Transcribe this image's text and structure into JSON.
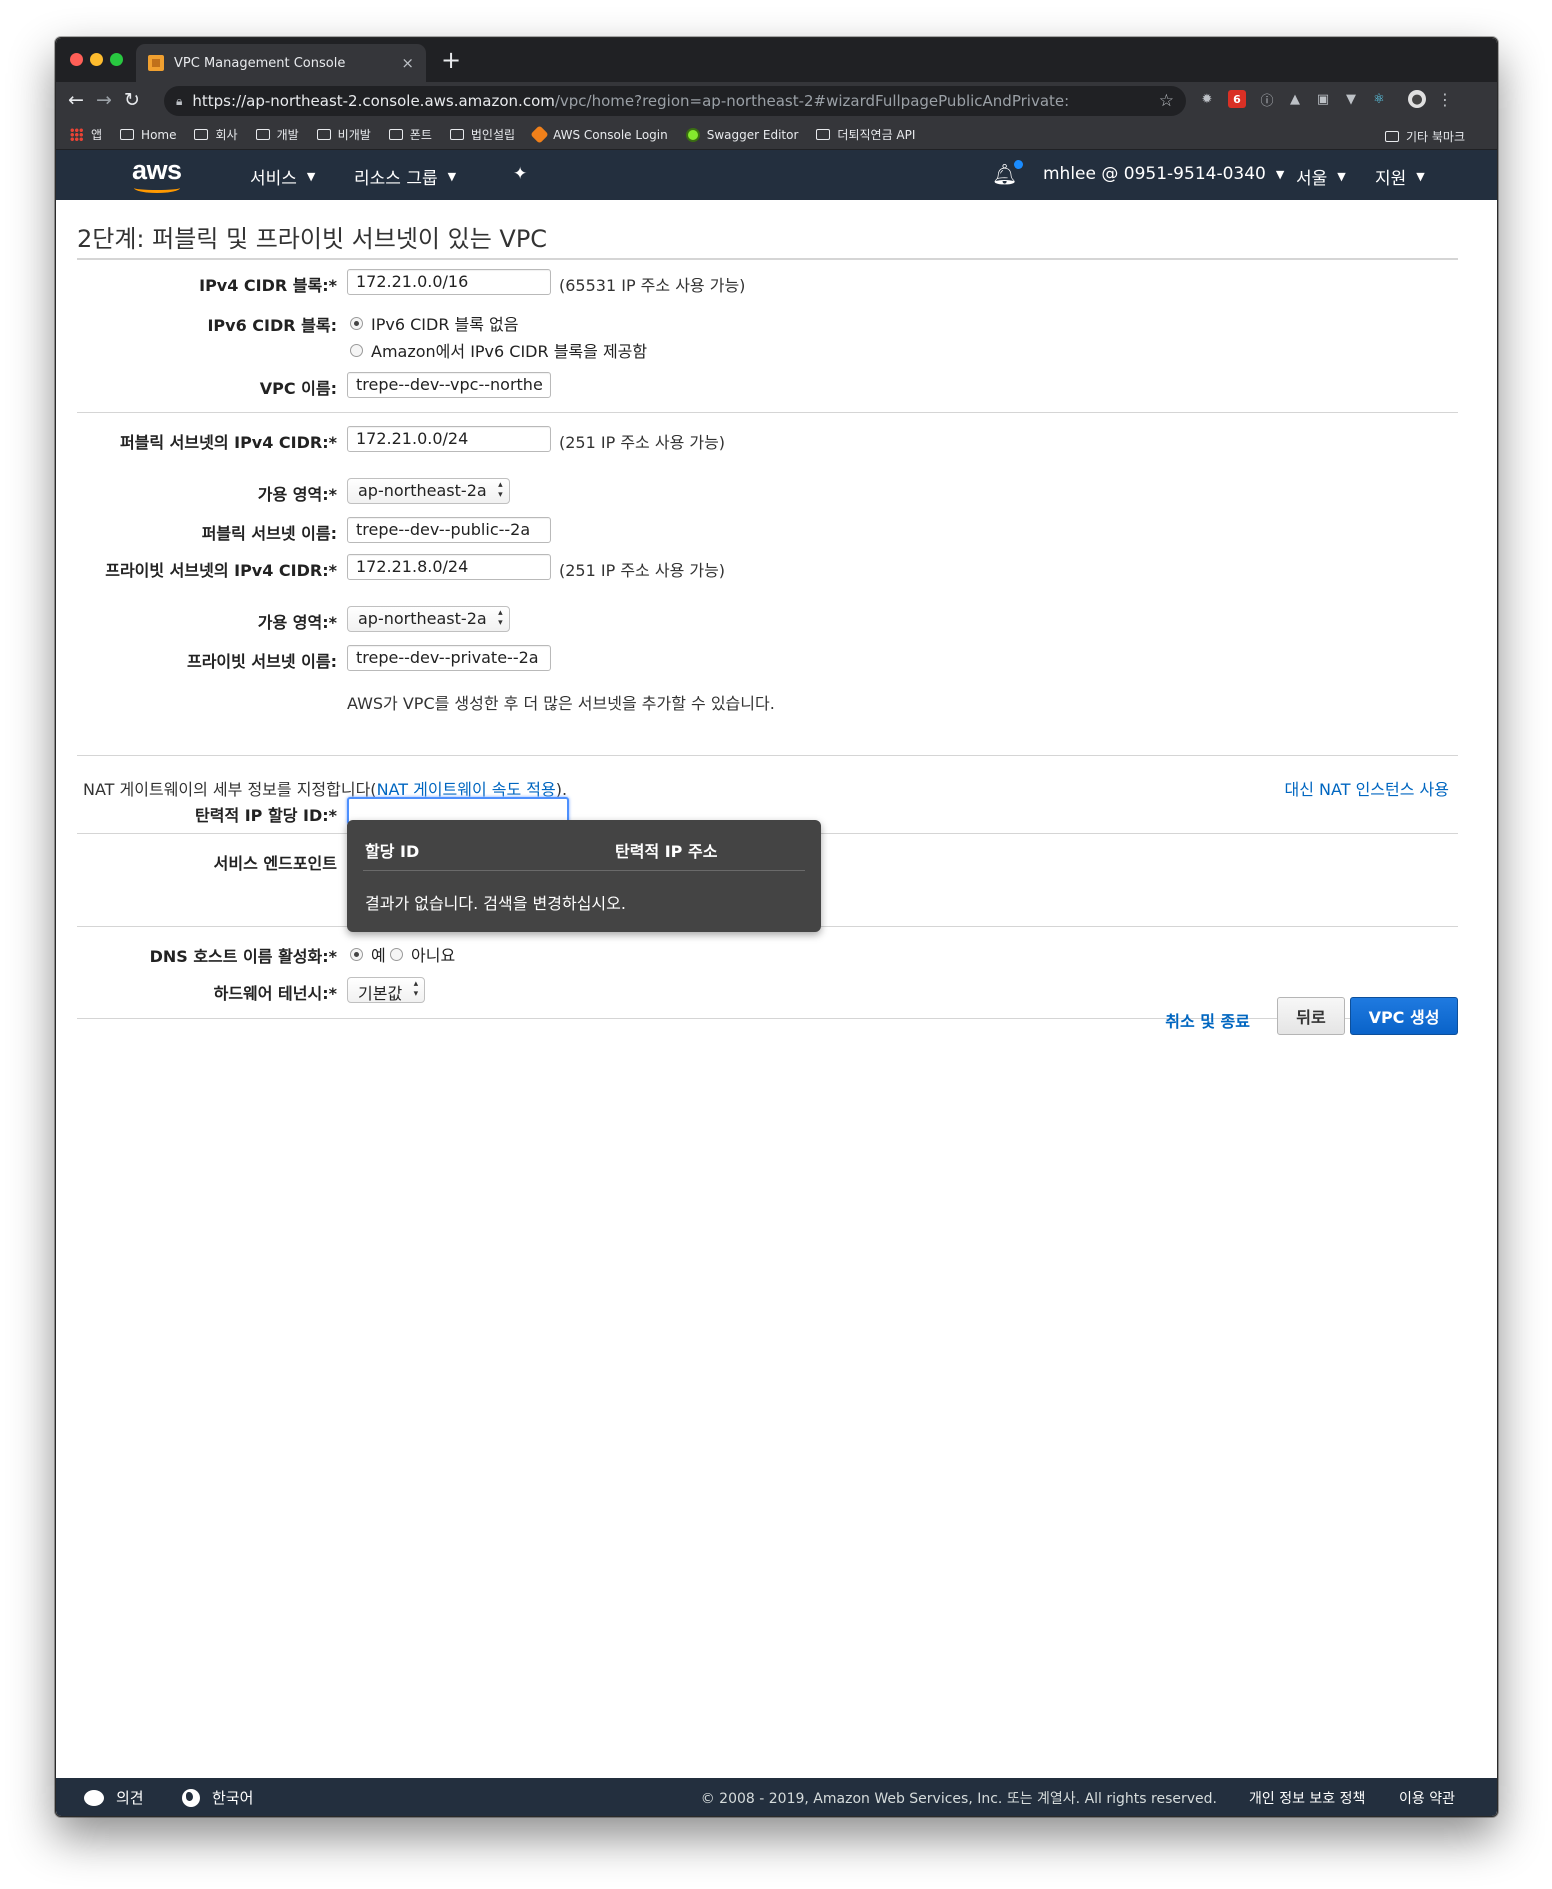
{
  "browser": {
    "tab_title": "VPC Management Console",
    "tab_close": "×",
    "new_tab": "+",
    "url_host": "https://ap-northeast-2.console.aws.amazon.com",
    "url_path": "/vpc/home?region=ap-northeast-2#wizardFullpagePublicAndPrivate:",
    "gmail_badge": "6",
    "bookmarks": [
      "앱",
      "Home",
      "회사",
      "개발",
      "비개발",
      "폰트",
      "법인설립",
      "AWS Console Login",
      "Swagger Editor",
      "더퇴직연금 API"
    ],
    "other_bookmarks": "기타 북마크"
  },
  "aws_nav": {
    "logo": "aws",
    "services": "서비스",
    "resource_groups": "리소스 그룹",
    "account": "mhlee @ 0951-9514-0340",
    "region": "서울",
    "support": "지원"
  },
  "page": {
    "title": "2단계: 퍼블릭 및 프라이빗 서브넷이 있는 VPC",
    "ipv4_cidr_label": "IPv4 CIDR 블록:*",
    "ipv4_cidr_value": "172.21.0.0/16",
    "ipv4_cidr_hint": "(65531 IP 주소 사용 가능)",
    "ipv6_cidr_label": "IPv6 CIDR 블록:",
    "ipv6_option_none": "IPv6 CIDR 블록 없음",
    "ipv6_option_amazon": "Amazon에서 IPv6 CIDR 블록을 제공함",
    "vpc_name_label": "VPC 이름:",
    "vpc_name_value": "trepe--dev--vpc--northe",
    "public_cidr_label": "퍼블릭 서브넷의 IPv4 CIDR:*",
    "public_cidr_value": "172.21.0.0/24",
    "public_cidr_hint": "(251 IP 주소 사용 가능)",
    "public_az_label": "가용 영역:*",
    "public_az_value": "ap-northeast-2a",
    "public_name_label": "퍼블릭 서브넷 이름:",
    "public_name_value": "trepe--dev--public--2a",
    "private_cidr_label": "프라이빗 서브넷의 IPv4 CIDR:*",
    "private_cidr_value": "172.21.8.0/24",
    "private_cidr_hint": "(251 IP 주소 사용 가능)",
    "private_az_label": "가용 영역:*",
    "private_az_value": "ap-northeast-2a",
    "private_name_label": "프라이빗 서브넷 이름:",
    "private_name_value": "trepe--dev--private--2a",
    "more_subnets_note": "AWS가 VPC를 생성한 후 더 많은 서브넷을 추가할 수 있습니다.",
    "nat_desc_prefix": "NAT 게이트웨이의 세부 정보를 지정합니다(",
    "nat_desc_link": "NAT 게이트웨이 속도 적용",
    "nat_desc_suffix": ").",
    "nat_instance_link": "대신 NAT 인스턴스 사용",
    "eip_label": "탄력적 IP 할당 ID:*",
    "eip_value": "",
    "endpoints_label": "서비스 엔드포인트",
    "dns_label": "DNS 호스트 이름 활성화:*",
    "dns_yes": "예",
    "dns_no": "아니요",
    "tenancy_label": "하드웨어 테넌시:*",
    "tenancy_value": "기본값",
    "cancel": "취소 및 종료",
    "back": "뒤로",
    "create": "VPC 생성"
  },
  "popover": {
    "col_allocation_id": "할당 ID",
    "col_eip": "탄력적 IP 주소",
    "empty_message": "결과가 없습니다. 검색을 변경하십시오."
  },
  "footer": {
    "feedback": "의견",
    "language": "한국어",
    "copyright": "© 2008 - 2019, Amazon Web Services, Inc. 또는 계열사. All rights reserved.",
    "privacy": "개인 정보 보호 정책",
    "terms": "이용 약관"
  },
  "colors": {
    "aws_nav_bg": "#232f3e",
    "aws_orange": "#ff9900",
    "link": "#0066c0",
    "primary_button": "#0a63c9"
  }
}
